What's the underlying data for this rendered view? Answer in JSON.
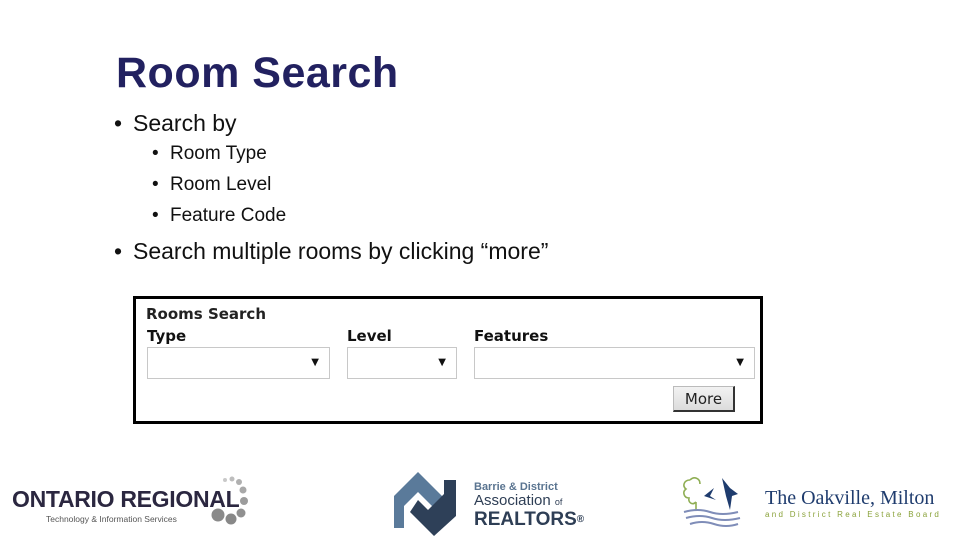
{
  "slide": {
    "title": "Room Search",
    "bullets": [
      {
        "text": "Search by",
        "sub": [
          "Room Type",
          "Room Level",
          "Feature Code"
        ]
      },
      {
        "text": "Search multiple rooms by clicking “more”"
      }
    ],
    "bullet_glyph": "•",
    "title_color": "#222160"
  },
  "rooms_search": {
    "heading": "Rooms Search",
    "fields": [
      {
        "label": "Type",
        "value": ""
      },
      {
        "label": "Level",
        "value": ""
      },
      {
        "label": "Features",
        "value": ""
      }
    ],
    "dropdown_arrow": "▼",
    "more_button": "More"
  },
  "logos": {
    "ontario": {
      "name": "ONTARIO REGIONAL",
      "tagline": "Technology & Information Services"
    },
    "barrie": {
      "line1": "Barrie & District",
      "line2": "Association",
      "line2_suffix": "of",
      "line3": "REALTORS",
      "reg": "®"
    },
    "oakville": {
      "name": "The Oakville, Milton",
      "tagline": "and District Real Estate Board"
    }
  }
}
